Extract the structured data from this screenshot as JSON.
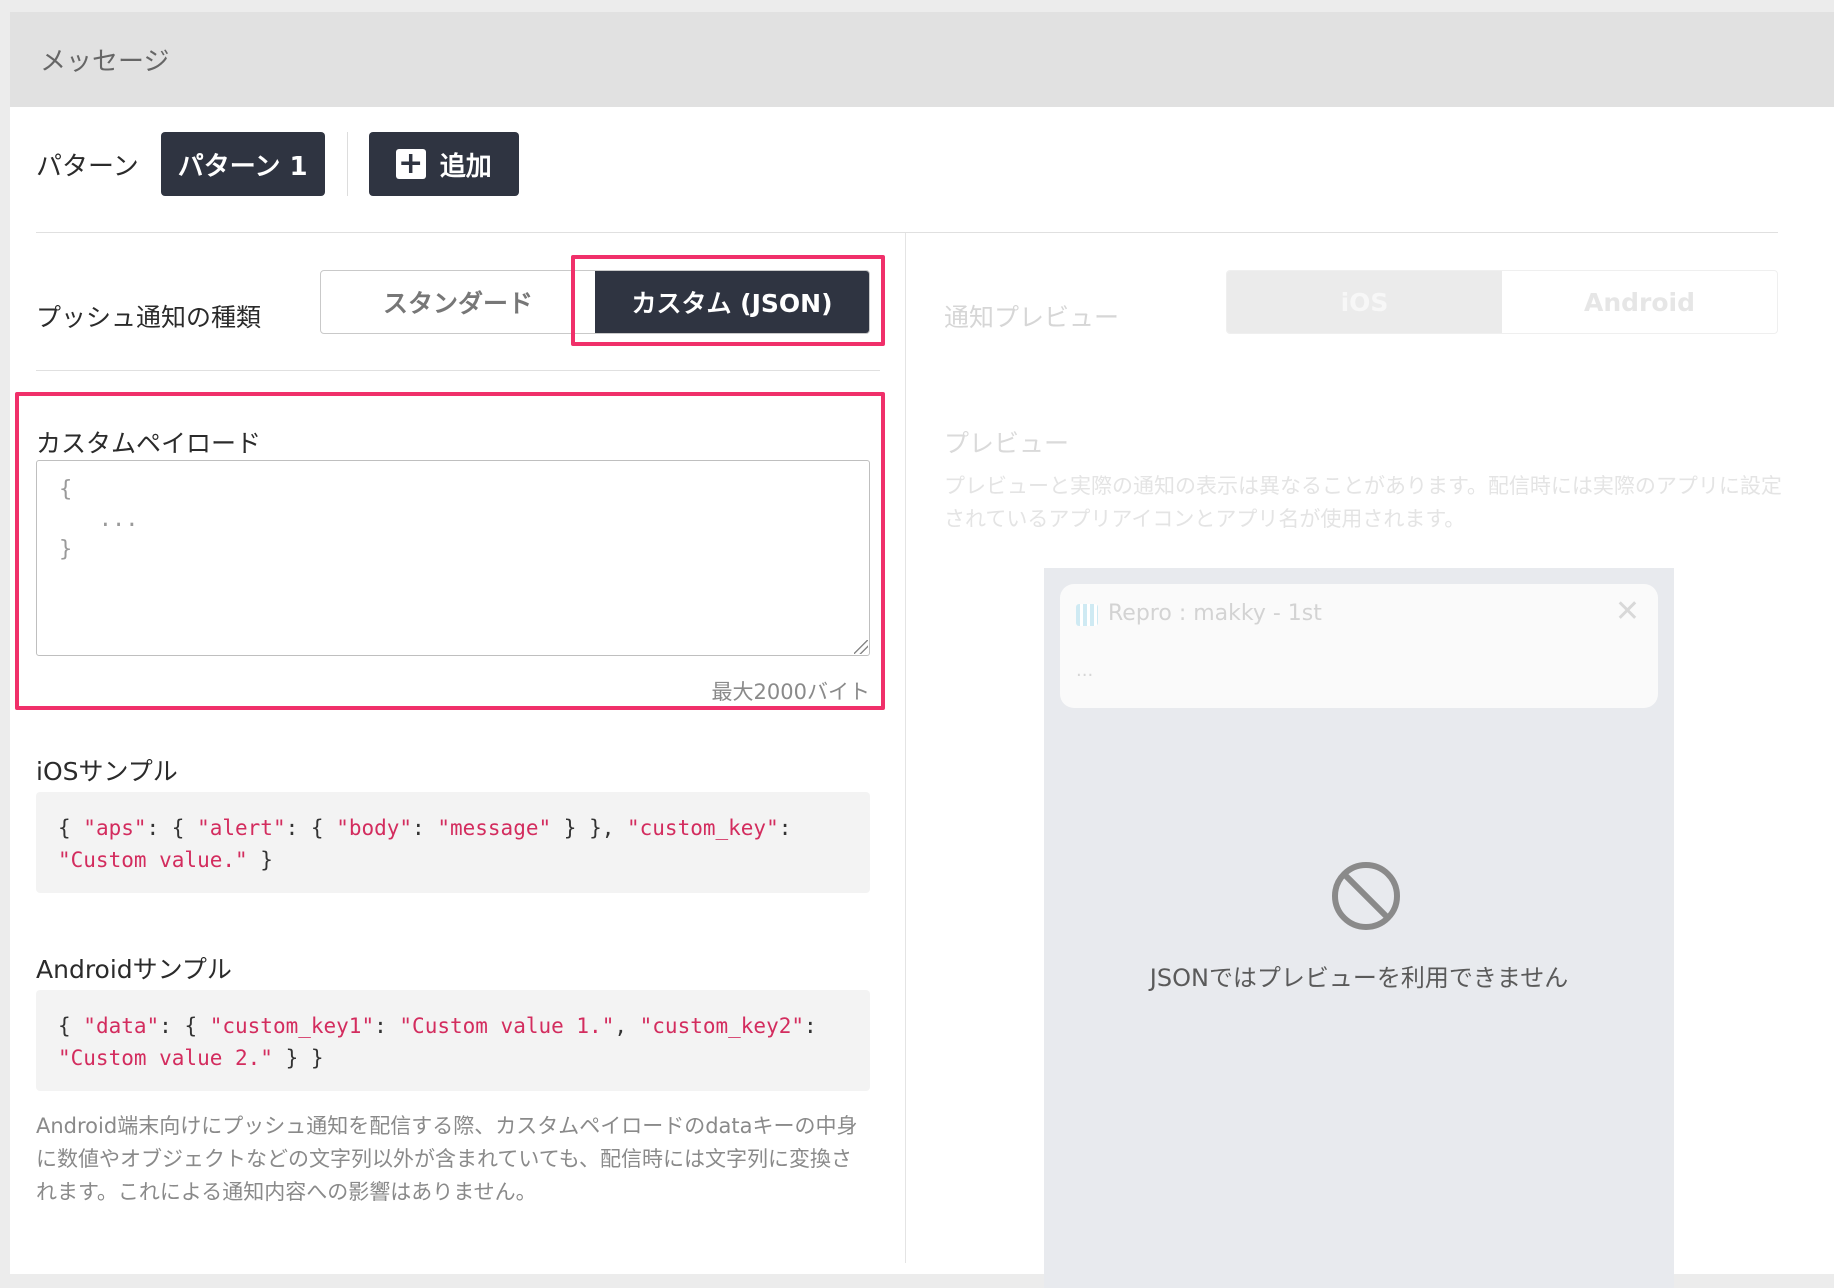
{
  "header": {
    "title": "メッセージ"
  },
  "pattern": {
    "label": "パターン",
    "active_pattern": "パターン 1",
    "add_label": "追加",
    "add_icon": "plus-icon"
  },
  "push_type": {
    "label": "プッシュ通知の種類",
    "options": [
      "スタンダード",
      "カスタム (JSON)"
    ],
    "selected": "カスタム (JSON)"
  },
  "payload": {
    "label": "カスタムペイロード",
    "placeholder": "{\n   ...\n}",
    "max_bytes": "最大2000バイト"
  },
  "ios_sample": {
    "label": "iOSサンプル",
    "code": [
      {
        "t": "{ ",
        "s": false
      },
      {
        "t": "\"aps\"",
        "s": true
      },
      {
        "t": ": { ",
        "s": false
      },
      {
        "t": "\"alert\"",
        "s": true
      },
      {
        "t": ": { ",
        "s": false
      },
      {
        "t": "\"body\"",
        "s": true
      },
      {
        "t": ": ",
        "s": false
      },
      {
        "t": "\"message\"",
        "s": true
      },
      {
        "t": " } }, ",
        "s": false
      },
      {
        "t": "\"custom_key\"",
        "s": true
      },
      {
        "t": ": ",
        "s": false
      },
      {
        "t": "\"Custom value.\"",
        "s": true
      },
      {
        "t": " }",
        "s": false
      }
    ]
  },
  "android_sample": {
    "label": "Androidサンプル",
    "code": [
      {
        "t": "{ ",
        "s": false
      },
      {
        "t": "\"data\"",
        "s": true
      },
      {
        "t": ": { ",
        "s": false
      },
      {
        "t": "\"custom_key1\"",
        "s": true
      },
      {
        "t": ": ",
        "s": false
      },
      {
        "t": "\"Custom value 1.\"",
        "s": true
      },
      {
        "t": ", ",
        "s": false
      },
      {
        "t": "\"custom_key2\"",
        "s": true
      },
      {
        "t": ": ",
        "s": false
      },
      {
        "t": "\"Custom value 2.\"",
        "s": true
      },
      {
        "t": " } }",
        "s": false
      }
    ],
    "note": "Android端末向けにプッシュ通知を配信する際、カスタムペイロードのdataキーの中身に数値やオブジェクトなどの文字列以外が含まれていても、配信時には文字列に変換されます。これによる通知内容への影響はありません。"
  },
  "preview": {
    "label": "通知プレビュー",
    "os_options": [
      "iOS",
      "Android"
    ],
    "selected_os": "iOS",
    "title": "プレビュー",
    "description": "プレビューと実際の通知の表示は異なることがあります。配信時には実際のアプリに設定されているアプリアイコンとアプリ名が使用されます。",
    "app_name": "Repro : makky - 1st",
    "notification_body": "...",
    "unavailable_text": "JSONではプレビューを利用できません",
    "unavailable_icon": "ban-icon"
  },
  "colors": {
    "highlight": "#f0306a",
    "dark_button": "#2f3441",
    "code_string": "#d32c5e"
  }
}
